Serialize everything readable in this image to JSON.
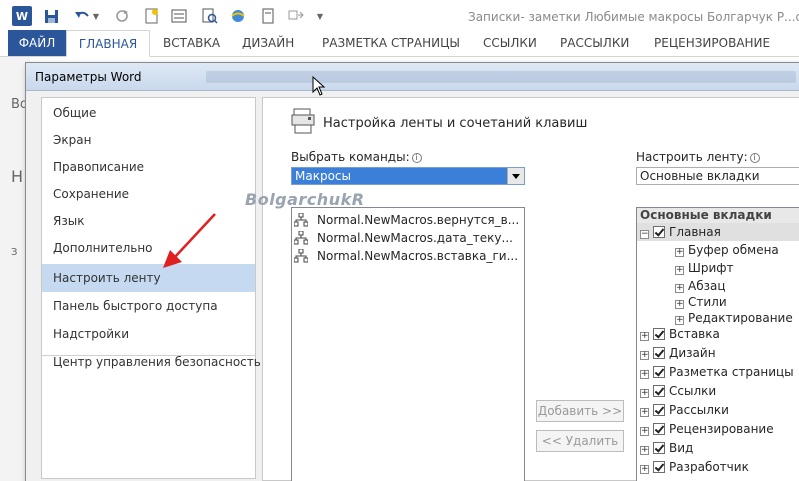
{
  "window_title": "Записки- заметки Любимые макросы Болгарчук Р...docx -",
  "ribbon_tabs": [
    "ФАЙЛ",
    "ГЛАВНАЯ",
    "ВСТАВКА",
    "ДИЗАЙН",
    "РАЗМЕТКА СТРАНИЦЫ",
    "ССЫЛКИ",
    "РАССЫЛКИ",
    "РЕЦЕНЗИРОВАНИЕ"
  ],
  "bg_letters": [
    "Во",
    "Н",
    "З"
  ],
  "dialog": {
    "title": "Параметры Word",
    "nav_items": [
      "Общие",
      "Экран",
      "Правописание",
      "Сохранение",
      "Язык",
      "Дополнительно",
      "Настроить ленту",
      "Панель быстрого доступа",
      "Надстройки",
      "Центр управления безопасностью"
    ],
    "selected_nav": "Настроить ленту",
    "section_title": "Настройка ленты и сочетаний клавиш",
    "choose_commands_label": "Выбрать команды:",
    "choose_commands_value": "Макросы",
    "customize_ribbon_label": "Настроить ленту:",
    "customize_ribbon_value": "Основные вкладки",
    "macros": [
      "Normal.NewMacros.вернутся_в...",
      "Normal.NewMacros.дата_теку...",
      "Normal.NewMacros.вставка_ги..."
    ],
    "add_button": "Добавить >>",
    "remove_button": "<< Удалить",
    "tree_header": "Основные вкладки",
    "tree": {
      "home": "Главная",
      "home_groups": [
        "Буфер обмена",
        "Шрифт",
        "Абзац",
        "Стили",
        "Редактирование"
      ],
      "tabs": [
        "Вставка",
        "Дизайн",
        "Разметка страницы",
        "Ссылки",
        "Рассылки",
        "Рецензирование",
        "Вид",
        "Разработчик"
      ]
    }
  },
  "watermark": "BolgarchukR",
  "colors": {
    "accent": "#2b579a",
    "selected_nav": "#c5d9f1",
    "combo_highlight": "#3c7fd8",
    "arrow": "#e02020"
  },
  "icons": [
    "word-logo-icon",
    "save-icon",
    "undo-icon",
    "redo-icon",
    "new-doc-icon",
    "form-icon",
    "print-preview-icon",
    "web-icon",
    "touch-icon",
    "macro-icon",
    "ribbon-settings-icon",
    "info-icon",
    "mouse-cursor-icon",
    "arrow-annotation-icon"
  ]
}
